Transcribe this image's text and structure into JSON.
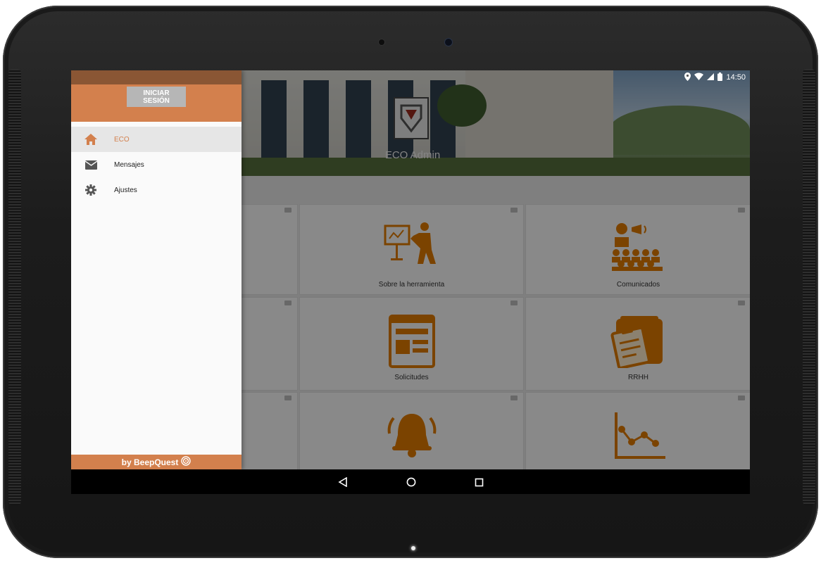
{
  "status_bar": {
    "time": "14:50",
    "icons": [
      "location-icon",
      "wifi-icon",
      "signal-icon",
      "battery-icon"
    ]
  },
  "hero": {
    "title": "ECO Admin"
  },
  "drawer": {
    "login_button": "INICIAR SESIÓN",
    "items": [
      {
        "label": "ECO",
        "icon": "home-icon",
        "active": true
      },
      {
        "label": "Mensajes",
        "icon": "envelope-icon",
        "active": false
      },
      {
        "label": "Ajustes",
        "icon": "gear-icon",
        "active": false
      }
    ],
    "footer": "by BeepQuest"
  },
  "cards": [
    {
      "label": "Sobre la herramienta",
      "icon": "presentation-icon"
    },
    {
      "label": "Comunicados",
      "icon": "announcement-icon"
    },
    {
      "label": "Solicitudes",
      "icon": "form-icon"
    },
    {
      "label": "RRHH",
      "icon": "clipboard-icon"
    },
    {
      "label": "",
      "icon": "bell-icon"
    },
    {
      "label": "",
      "icon": "line-chart-icon"
    }
  ],
  "colors": {
    "accent": "#d3804d",
    "icon_orange": "#e07b00"
  }
}
